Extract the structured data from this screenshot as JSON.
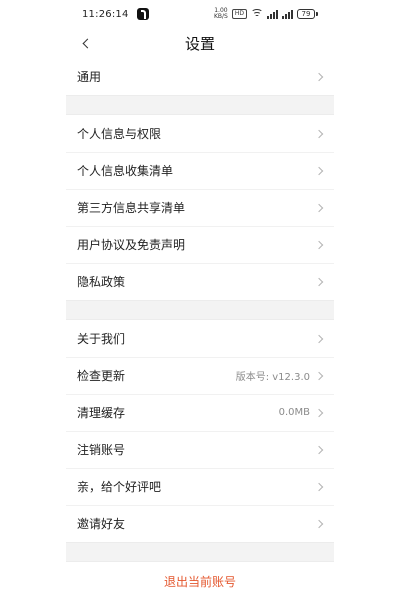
{
  "status_bar": {
    "time": "11:26:14",
    "network_speed": "1.00",
    "network_unit": "KB/S",
    "hd_label": "HD",
    "battery": "79"
  },
  "header": {
    "title": "设置"
  },
  "settings": {
    "group1": [
      {
        "label": "通用"
      }
    ],
    "group2": [
      {
        "label": "个人信息与权限"
      },
      {
        "label": "个人信息收集清单"
      },
      {
        "label": "第三方信息共享清单"
      },
      {
        "label": "用户协议及免责声明"
      },
      {
        "label": "隐私政策"
      }
    ],
    "group3": [
      {
        "label": "关于我们"
      },
      {
        "label": "检查更新",
        "value": "版本号: v12.3.0"
      },
      {
        "label": "清理缓存",
        "value": "0.0MB"
      },
      {
        "label": "注销账号"
      },
      {
        "label": "亲，给个好评吧"
      },
      {
        "label": "邀请好友"
      }
    ]
  },
  "logout": {
    "label": "退出当前账号"
  },
  "colors": {
    "logout": "#e4572e",
    "background_gap": "#f3f3f3"
  },
  "icons": {
    "back": "back-arrow-icon",
    "chevron": "chevron-right-icon",
    "wifi": "wifi-icon",
    "signal": "signal-icon",
    "battery": "battery-icon",
    "app": "tiktok-app-icon"
  }
}
